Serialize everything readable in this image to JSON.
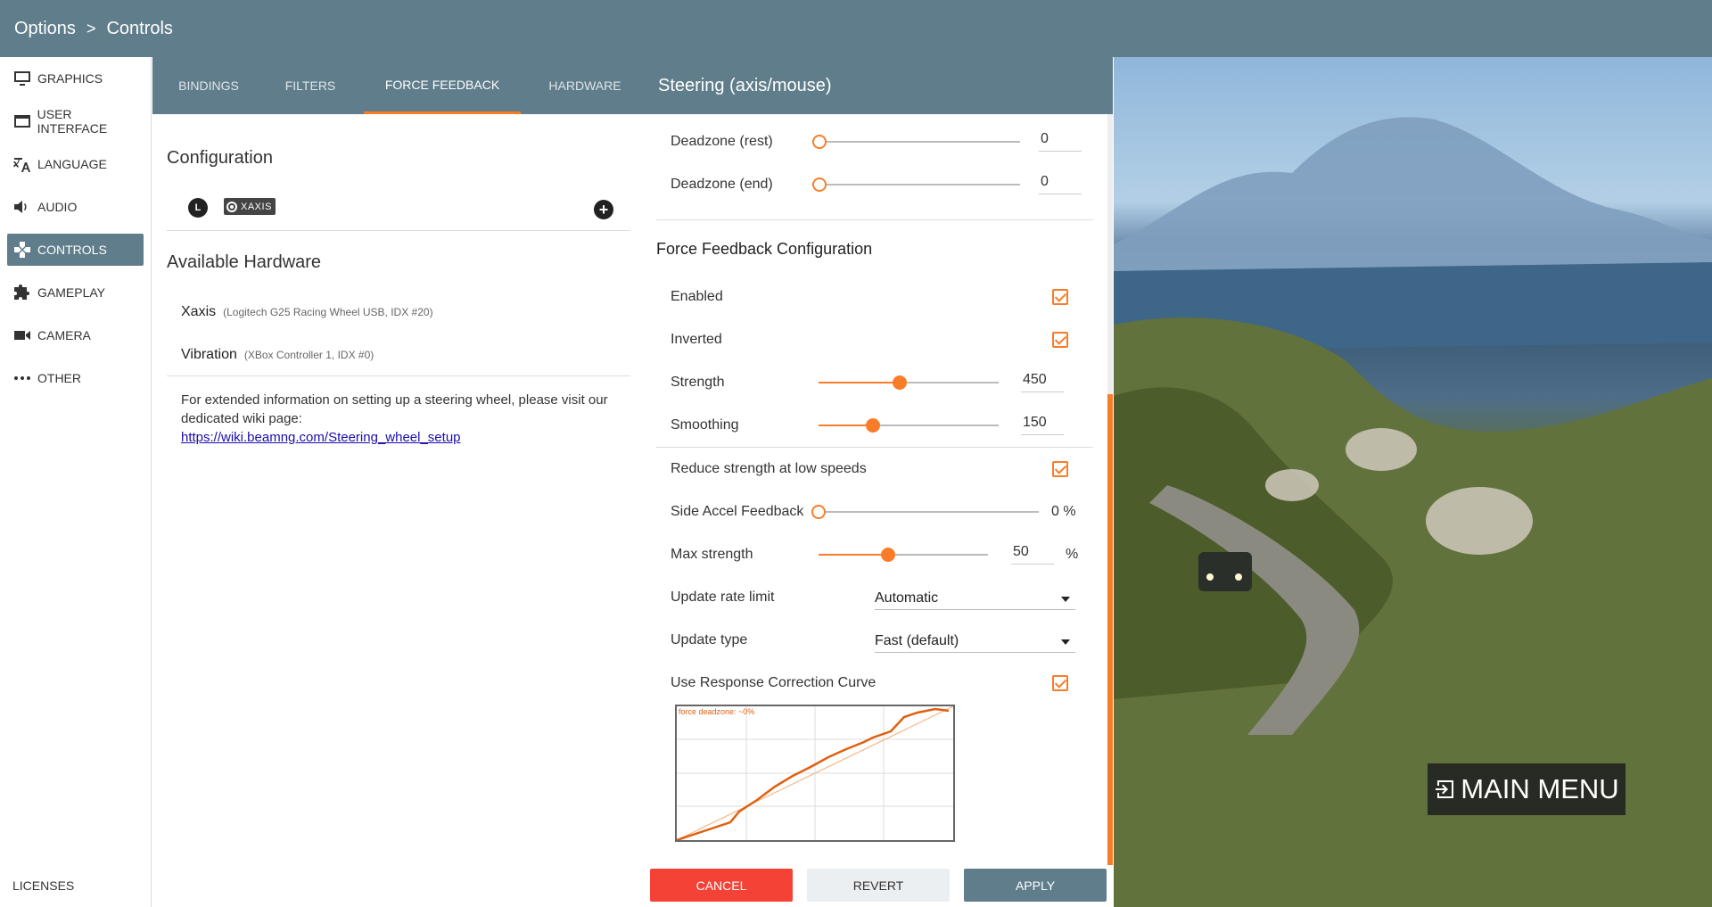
{
  "breadcrumb": {
    "root": "Options",
    "separator": ">",
    "current": "Controls"
  },
  "sidebar": {
    "items": [
      {
        "label": "GRAPHICS",
        "icon": "monitor-icon"
      },
      {
        "label": "USER INTERFACE",
        "icon": "window-icon"
      },
      {
        "label": "LANGUAGE",
        "icon": "translate-icon"
      },
      {
        "label": "AUDIO",
        "icon": "speaker-icon"
      },
      {
        "label": "CONTROLS",
        "icon": "gamepad-icon",
        "active": true
      },
      {
        "label": "GAMEPLAY",
        "icon": "puzzle-icon"
      },
      {
        "label": "CAMERA",
        "icon": "video-camera-icon"
      },
      {
        "label": "OTHER",
        "icon": "more-dots-icon"
      }
    ],
    "licenses": "LICENSES"
  },
  "tabs": [
    {
      "label": "BINDINGS"
    },
    {
      "label": "FILTERS"
    },
    {
      "label": "FORCE FEEDBACK",
      "active": true
    },
    {
      "label": "HARDWARE"
    }
  ],
  "left": {
    "configuration_title": "Configuration",
    "config_device_icon": "L",
    "config_badge": "XAXIS",
    "add_symbol": "+",
    "available_hardware_title": "Available Hardware",
    "hardware": [
      {
        "name": "Xaxis",
        "desc": "(Logitech G25 Racing Wheel USB, IDX #20)"
      },
      {
        "name": "Vibration",
        "desc": "(XBox Controller 1, IDX #0)"
      }
    ],
    "info_text": "For extended information on setting up a steering wheel, please visit our dedicated wiki page:",
    "info_link": "https://wiki.beamng.com/Steering_wheel_setup"
  },
  "panel": {
    "title": "Steering (axis/mouse)",
    "deadzone_rest": {
      "label": "Deadzone (rest)",
      "value": "0",
      "fraction": 0
    },
    "deadzone_end": {
      "label": "Deadzone (end)",
      "value": "0",
      "fraction": 0
    },
    "ffb_title": "Force Feedback Configuration",
    "enabled": {
      "label": "Enabled",
      "checked": true
    },
    "inverted": {
      "label": "Inverted",
      "checked": true
    },
    "strength": {
      "label": "Strength",
      "value": "450",
      "fraction": 0.45
    },
    "smoothing": {
      "label": "Smoothing",
      "value": "150",
      "fraction": 0.3
    },
    "reduce_low_speed": {
      "label": "Reduce strength at low speeds",
      "checked": true
    },
    "side_accel": {
      "label": "Side Accel Feedback",
      "value": "0 %",
      "fraction": 0
    },
    "max_strength": {
      "label": "Max strength",
      "value": "50",
      "unit": "%",
      "fraction": 0.5
    },
    "update_rate": {
      "label": "Update rate limit",
      "selected": "Automatic"
    },
    "update_type": {
      "label": "Update type",
      "selected": "Fast (default)"
    },
    "response_curve": {
      "label": "Use Response Correction Curve",
      "checked": true,
      "legend": "force deadzone: ~0%"
    }
  },
  "buttons": {
    "cancel": "CANCEL",
    "revert": "REVERT",
    "apply": "APPLY"
  },
  "game": {
    "main_menu": "MAIN MENU"
  },
  "colors": {
    "header": "#607d8b",
    "accent": "#f97d29",
    "cancel": "#f44336"
  }
}
